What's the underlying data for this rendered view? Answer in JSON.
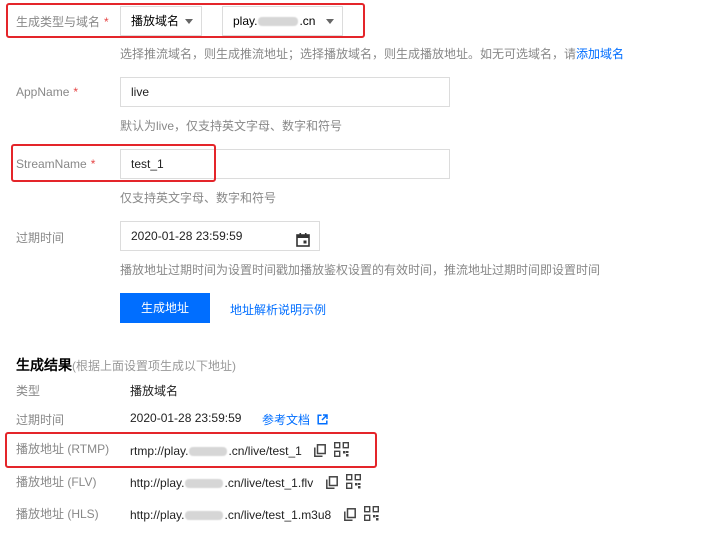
{
  "form": {
    "gen_type": {
      "label": "生成类型与域名",
      "required_mark": "*",
      "type_value": "播放域名",
      "domain_prefix": "play.",
      "domain_suffix": ".cn",
      "hint": "选择推流域名，则生成推流地址；选择播放域名，则生成播放地址。如无可选域名，请",
      "hint_link": "添加域名"
    },
    "app_name": {
      "label": "AppName",
      "required_mark": "*",
      "value": "live",
      "hint": "默认为live，仅支持英文字母、数字和符号"
    },
    "stream_name": {
      "label": "StreamName",
      "required_mark": "*",
      "value": "test_1",
      "hint": "仅支持英文字母、数字和符号"
    },
    "expire": {
      "label": "过期时间",
      "value": "2020-01-28 23:59:59",
      "hint": "播放地址过期时间为设置时间戳加播放鉴权设置的有效时间，推流地址过期时间即设置时间"
    },
    "generate_button": "生成地址",
    "doc_link": "地址解析说明示例"
  },
  "result": {
    "title": "生成结果",
    "subtitle": "(根据上面设置项生成以下地址)",
    "type_label": "类型",
    "type_value": "播放域名",
    "expire_label": "过期时间",
    "expire_value": "2020-01-28 23:59:59",
    "ref_link": "参考文档",
    "rows": [
      {
        "label": "播放地址 (RTMP)",
        "prefix": "rtmp://play.",
        "suffix": ".cn/live/test_1"
      },
      {
        "label": "播放地址 (FLV)",
        "prefix": "http://play.",
        "suffix": ".cn/live/test_1.flv"
      },
      {
        "label": "播放地址 (HLS)",
        "prefix": "http://play.",
        "suffix": ".cn/live/test_1.m3u8"
      }
    ]
  },
  "icons": [
    "calendar-icon",
    "external-link-icon",
    "copy-icon",
    "qrcode-icon",
    "chevron-down-icon"
  ],
  "colors": {
    "primary": "#006eff",
    "highlight": "#e4252a",
    "required": "#e54545"
  }
}
